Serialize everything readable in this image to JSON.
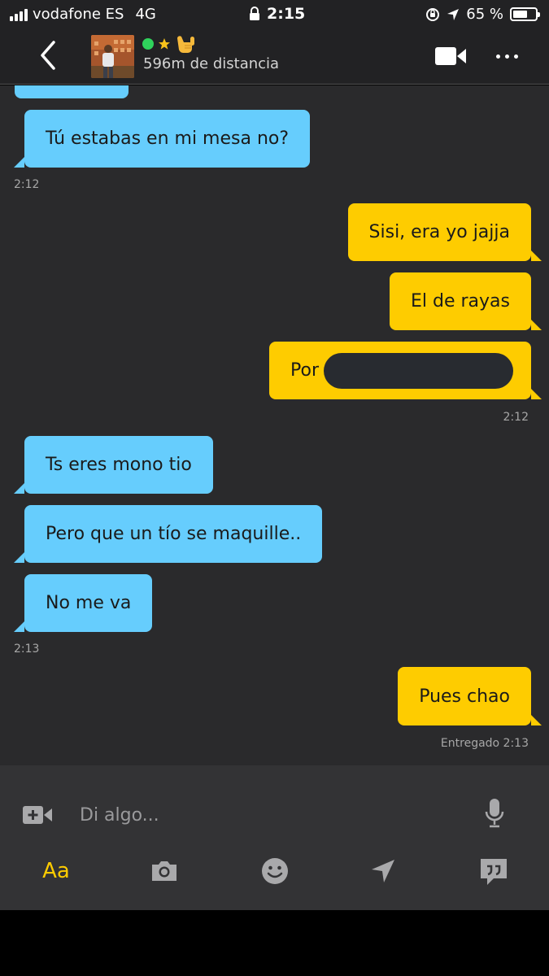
{
  "status_bar": {
    "carrier": "vodafone ES",
    "network": "4G",
    "time": "2:15",
    "battery_percent": "65 %",
    "battery_level": 0.65
  },
  "header": {
    "distance": "596m de distancia",
    "online": true,
    "online_color": "#2fd35c",
    "icons": [
      "back-chevron-icon",
      "star-icon",
      "call-me-hand-emoji",
      "video-camera-icon",
      "more-dots-icon"
    ]
  },
  "messages": [
    {
      "direction": "in",
      "text": ""
    },
    {
      "direction": "in",
      "text": "Tú estabas en mi mesa no?"
    },
    {
      "direction": "out",
      "text": "Sisi, era yo jajja"
    },
    {
      "direction": "out",
      "text": "El de rayas"
    },
    {
      "direction": "out",
      "text": "Por",
      "redacted": true
    },
    {
      "direction": "in",
      "text": "Ts eres mono tio"
    },
    {
      "direction": "in",
      "text": "Pero que un tío se maquille.."
    },
    {
      "direction": "in",
      "text": "No me va"
    },
    {
      "direction": "out",
      "text": "Pues chao"
    }
  ],
  "timestamps": {
    "t1": "2:12",
    "t2": "2:12",
    "t3": "2:13",
    "delivered": "Entregado 2:13"
  },
  "compose": {
    "placeholder": "Di algo...",
    "text_style_label": "Aa"
  },
  "colors": {
    "incoming_bubble": "#66cdfd",
    "outgoing_bubble": "#fecc00",
    "chat_background": "#2a2a2c",
    "accent": "#fecc00"
  }
}
